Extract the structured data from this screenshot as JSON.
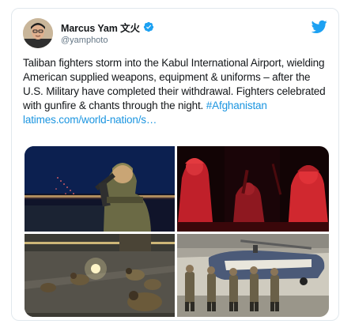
{
  "tweet": {
    "display_name": "Marcus Yam 文火",
    "handle": "@yamphoto",
    "text_body": "Taliban fighters storm into the Kabul International Airport, wielding American supplied weapons, equipment & uniforms – after the U.S. Military have completed their withdrawal. Fighters celebrated with gunfire & chants through the night. ",
    "hashtag": "#Afghanistan",
    "link": "latimes.com/world-nation/s…"
  },
  "icons": {
    "verified": "verified-badge-icon",
    "brand": "twitter-bird-icon"
  },
  "colors": {
    "text": "#14171a",
    "secondary": "#657786",
    "link": "#1b95e0",
    "twitter_blue": "#1da1f2",
    "border": "#e1e8ed"
  },
  "media": {
    "photos": [
      "night-airport-fighter",
      "red-light-fighters",
      "fighters-praying-tarmac",
      "fighters-by-helicopter"
    ]
  }
}
